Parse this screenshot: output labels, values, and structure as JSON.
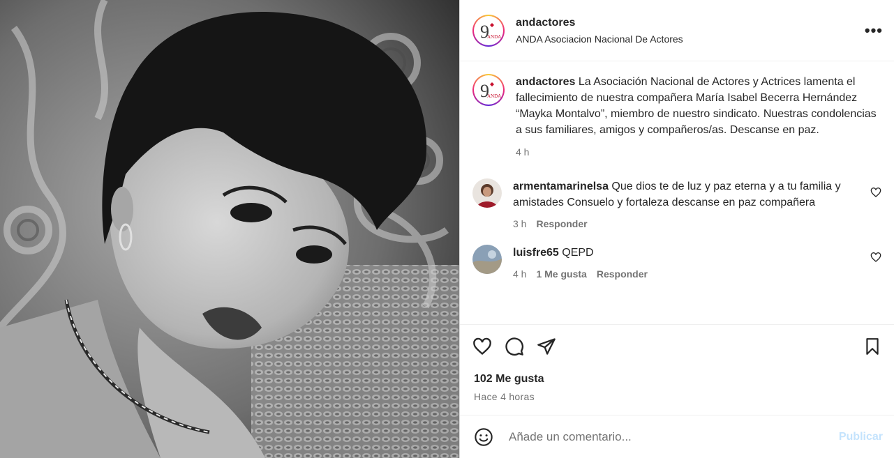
{
  "post": {
    "username": "andactores",
    "account_full_name": "ANDA Asociacion Nacional De Actores",
    "more_icon": "more-options-icon",
    "caption": {
      "username": "andactores",
      "text": "La Asociación Nacional de Actores y Actrices lamenta el fallecimiento de nuestra compañera María Isabel Becerra Hernández “Mayka Montalvo”, miembro de nuestro sindicato. Nuestras condolencias a sus familiares, amigos y compañeros/as. Descanse en paz.",
      "time": "4 h"
    },
    "comments": [
      {
        "username": "armentamarinelsa",
        "text": "Que dios te de luz y paz eterna y a tu familia y amistades Consuelo y fortaleza descanse en paz compañera",
        "time": "3 h",
        "likes": "",
        "reply": "Responder"
      },
      {
        "username": "luisfre65",
        "text": "QEPD",
        "time": "4 h",
        "likes": "1 Me gusta",
        "reply": "Responder"
      }
    ],
    "likes_text": "102 Me gusta",
    "posted_ago": "Hace 4 horas",
    "comment_input": {
      "placeholder": "Añade un comentario...",
      "publish_label": "Publicar"
    },
    "logo_text": "ANDA",
    "logo_number": "9",
    "colors": {
      "publish_disabled": "#c4e3fd",
      "secondary_text": "#737373",
      "primary_text": "#262626"
    }
  }
}
